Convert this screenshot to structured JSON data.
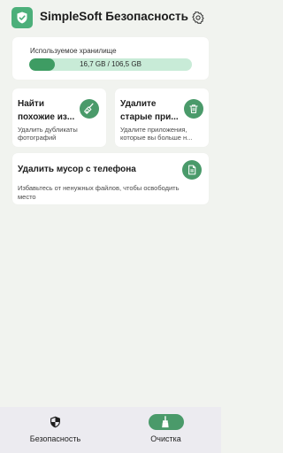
{
  "app": {
    "title": "SimpleSoft Безопасность",
    "logo_icon": "shield-check-icon",
    "settings_icon": "gear-icon"
  },
  "storage": {
    "label": "Используемое хранилище",
    "usage_text": "16,7 GB / 106,5 GB",
    "used_fraction": 0.157
  },
  "cards": {
    "similar_photos": {
      "title_line1": "Найти",
      "title_line2": "похожие из...",
      "desc_line1": "Удалить дубликаты",
      "desc_line2": "фотографий",
      "icon": "broom-icon"
    },
    "old_apps": {
      "title_line1": "Удалите",
      "title_line2": "старые при...",
      "desc_line1": "Удалите приложения,",
      "desc_line2": "которые вы больше н...",
      "icon": "trash-icon"
    },
    "junk": {
      "title": "Удалить мусор с телефона",
      "desc": "Избавьтесь от ненужных файлов, чтобы освободить место",
      "icon": "file-icon"
    }
  },
  "nav": {
    "security_label": "Безопасность",
    "security_icon": "shield-icon",
    "cleanup_label": "Очистка",
    "cleanup_icon": "broom-icon",
    "active": "Очистка"
  },
  "colors": {
    "accent": "#4a9a6a",
    "progress_fill": "#3e9c63",
    "progress_track": "#c8ebd7",
    "background": "#f1f3ef"
  }
}
